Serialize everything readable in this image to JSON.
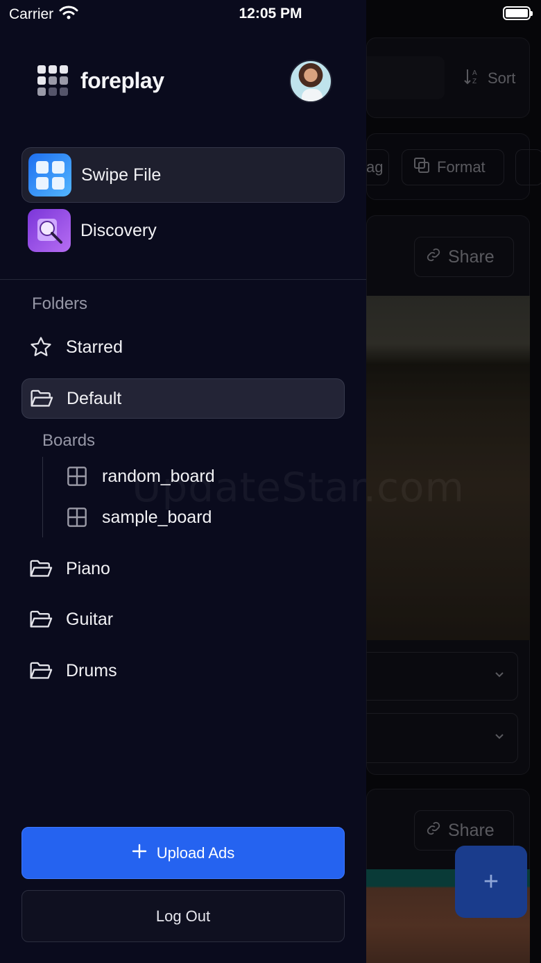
{
  "status_bar": {
    "carrier": "Carrier",
    "time": "12:05 PM"
  },
  "brand": {
    "name": "foreplay"
  },
  "apps": [
    {
      "label": "Swipe File",
      "icon": "swipe-file-icon",
      "active": true
    },
    {
      "label": "Discovery",
      "icon": "discovery-icon",
      "active": false
    }
  ],
  "folders_section": {
    "title": "Folders",
    "starred": "Starred",
    "default": "Default",
    "boards_title": "Boards",
    "boards": [
      "random_board",
      "sample_board"
    ],
    "others": [
      "Piano",
      "Guitar",
      "Drums"
    ]
  },
  "actions": {
    "upload": "Upload Ads",
    "logout": "Log Out"
  },
  "background": {
    "sort_label": "Sort",
    "tag_label": "ag",
    "format_label": "Format",
    "share_label": "Share",
    "fab_label": "+"
  },
  "watermark": "UpdateStar.com",
  "colors": {
    "drawer_bg": "#0a0b1d",
    "accent": "#2563f0"
  }
}
